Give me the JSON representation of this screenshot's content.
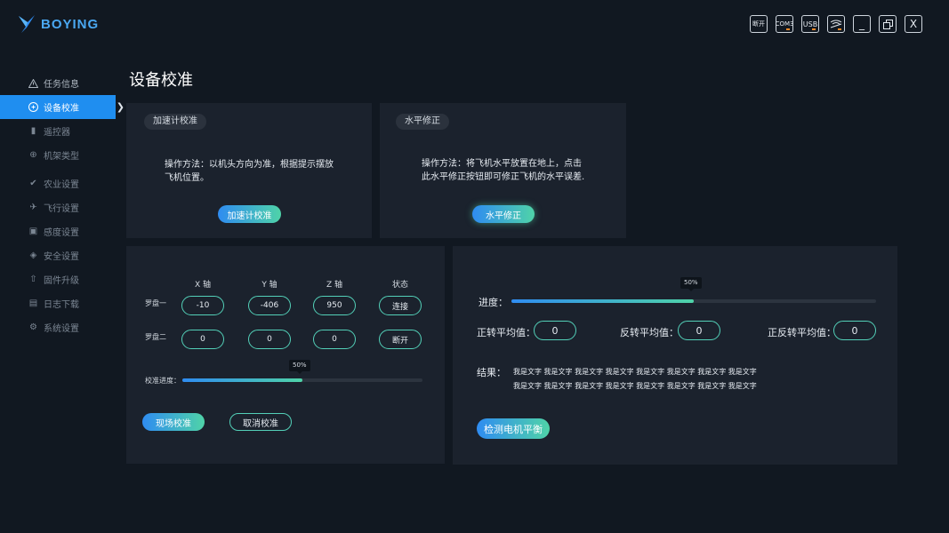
{
  "app": {
    "brand": "BOYING"
  },
  "window_controls": [
    "断开",
    "COM3",
    "USB",
    "",
    "_",
    "",
    "X"
  ],
  "sidebar": {
    "items": [
      {
        "label": "任务信息",
        "icon": "warning-icon"
      },
      {
        "label": "设备校准",
        "icon": "calibration-icon"
      },
      {
        "label": "遥控器",
        "icon": "remote-icon"
      },
      {
        "label": "机架类型",
        "icon": "frame-icon"
      },
      {
        "label": "农业设置",
        "icon": "leaf-icon"
      },
      {
        "label": "飞行设置",
        "icon": "plane-icon"
      },
      {
        "label": "感度设置",
        "icon": "sensitivity-icon"
      },
      {
        "label": "安全设置",
        "icon": "shield-icon"
      },
      {
        "label": "固件升级",
        "icon": "upgrade-icon"
      },
      {
        "label": "日志下载",
        "icon": "log-icon"
      },
      {
        "label": "系统设置",
        "icon": "gear-icon"
      }
    ]
  },
  "page": {
    "title": "设备校准"
  },
  "accel": {
    "chip": "加速计校准",
    "desc_line1": "操作方法：以机头方向为准，根据提示摆放",
    "desc_line2": "飞机位置。",
    "button": "加速计校准"
  },
  "level": {
    "chip": "水平修正",
    "desc_line1": "操作方法：将飞机水平放置在地上，点击",
    "desc_line2": "此水平修正按钮即可修正飞机的水平误差.",
    "button": "水平修正"
  },
  "compass": {
    "headers": [
      "X 轴",
      "Y 轴",
      "Z 轴",
      "状态"
    ],
    "rows": [
      {
        "label": "罗盘一",
        "x": "-10",
        "y": "-406",
        "z": "950",
        "status": "连接"
      },
      {
        "label": "罗盘二",
        "x": "0",
        "y": "0",
        "z": "0",
        "status": "断开"
      }
    ],
    "progress_label": "校准进度：",
    "progress_tip": "50%",
    "progress": 0.5,
    "start_button": "现场校准",
    "cancel_button": "取消校准"
  },
  "motor": {
    "progress_label": "进度：",
    "progress_tip": "50%",
    "progress": 0.5,
    "forward_label": "正转平均值：",
    "forward_value": "0",
    "reverse_label": "反转平均值：",
    "reverse_value": "0",
    "both_label": "正反转平均值：",
    "both_value": "0",
    "result_label": "结果：",
    "result_line1": "我是文字 我是文字 我是文字 我是文字 我是文字 我是文字 我是文字 我是文字",
    "result_line2": "我是文字 我是文字 我是文字 我是文字 我是文字 我是文字 我是文字 我是文字",
    "button": "检测电机平衡"
  },
  "colors": {
    "accent": "#1f8ef0",
    "teal": "#53d0b8",
    "panel": "#1b222d",
    "bg": "#111821"
  }
}
